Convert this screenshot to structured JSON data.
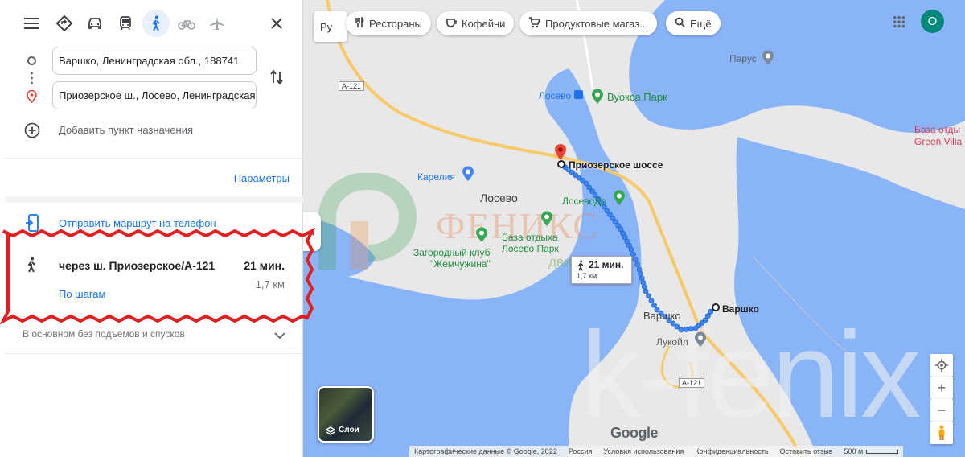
{
  "toolbar": {
    "menu_icon": "menu-icon",
    "modes": [
      "directions-icon",
      "car-icon",
      "transit-icon",
      "walk-icon",
      "bike-icon",
      "plane-icon"
    ],
    "active_mode": "walk-icon"
  },
  "directions": {
    "origin": "Варшко, Ленинградская обл., 188741",
    "destination": "Приозерское ш., Лосево, Ленинградская обл.",
    "add_destination": "Добавить пункт назначения",
    "params_label": "Параметры"
  },
  "route": {
    "send_to_phone": "Отправить маршрут на телефон",
    "via": "через ш. Приозерское/А-121",
    "duration": "21 мин.",
    "distance": "1,7 км",
    "steps_link": "По шагам",
    "note": "В основном без подъемов и спусков"
  },
  "map": {
    "lang_select": "Ру",
    "chips": [
      {
        "icon": "restaurant-icon",
        "label": "Рестораны"
      },
      {
        "icon": "coffee-icon",
        "label": "Кофейни"
      },
      {
        "icon": "cart-icon",
        "label": "Продуктовые магаз..."
      },
      {
        "icon": "search-icon",
        "label": "Ещё"
      }
    ],
    "avatar_letter": "О",
    "labels": {
      "road_a121_top": "А-121",
      "road_a121_bottom": "А-121",
      "losevo_station": "Лосево",
      "vuoksa_park": "Вуокса Парк",
      "parus": "Парус",
      "base_line1": "База отды",
      "base_line2": "Green Villa",
      "priozerskoe": "Приозерское шоссе",
      "karelia": "Карелия",
      "losevo_town": "Лосево",
      "losevo_dv": "ЛосевоДв",
      "base_losevo_1": "База отдыха",
      "base_losevo_2": "Лосево Парк",
      "club_1": "Загородный клуб",
      "club_2": "\"Жемчужина\"",
      "varshko_pin": "Варшко",
      "varshko_town": "Варшко",
      "lukoil": "Лукойл"
    },
    "route_box": {
      "time": "21 мин.",
      "dist": "1,7 км"
    },
    "layers_label": "Слои",
    "google": "Google",
    "footer": {
      "data": "Картографические данные © Google, 2022",
      "country": "Россия",
      "terms": "Условия использования",
      "privacy": "Конфиденциальность",
      "feedback": "Оставить отзыв",
      "scale": "500 м"
    },
    "watermark_big": "k-fenix",
    "watermark_small_1": "ФЕНИКС",
    "watermark_small_2": "движимость"
  }
}
